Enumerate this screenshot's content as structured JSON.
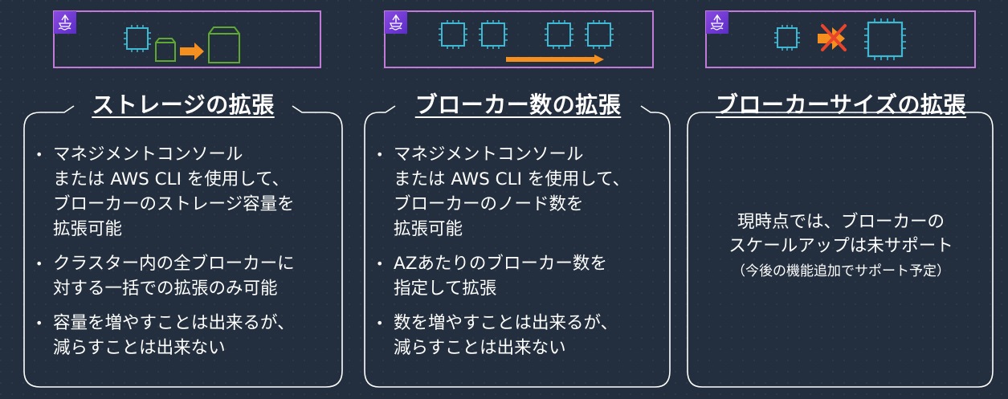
{
  "columns": [
    {
      "heading": "ストレージの拡張",
      "bullets": [
        [
          "マネジメントコンソール",
          "または AWS CLI を使用して、",
          "ブローカーのストレージ容量を",
          "拡張可能"
        ],
        [
          "クラスター内の全ブローカーに",
          "対する一括での拡張のみ可能"
        ],
        [
          "容量を増やすことは出来るが、",
          "減らすことは出来ない"
        ]
      ]
    },
    {
      "heading": "ブローカー数の拡張",
      "bullets": [
        [
          "マネジメントコンソール",
          "または AWS CLI を使用して、",
          "ブローカーのノード数を",
          "拡張可能"
        ],
        [
          "AZあたりのブローカー数を",
          "指定して拡張"
        ],
        [
          "数を増やすことは出来るが、",
          "減らすことは出来ない"
        ]
      ]
    },
    {
      "heading": "ブローカーサイズの拡張",
      "message": [
        "現時点では、ブローカーの",
        "スケールアップは未サポート"
      ],
      "note": "（今後の機能追加でサポート予定）"
    }
  ],
  "icons": {
    "service_badge": "amazon-msk-icon",
    "chip": "broker-chip-icon",
    "storage": "storage-volume-icon",
    "arrow": "orange-arrow-icon",
    "cross": "red-cross-icon"
  },
  "colors": {
    "background": "#232f3e",
    "diagram_border": "#c27ad9",
    "chip": "#3fb8d4",
    "storage": "#5fa832",
    "arrow": "#f58f1f",
    "cross": "#e8452c"
  }
}
